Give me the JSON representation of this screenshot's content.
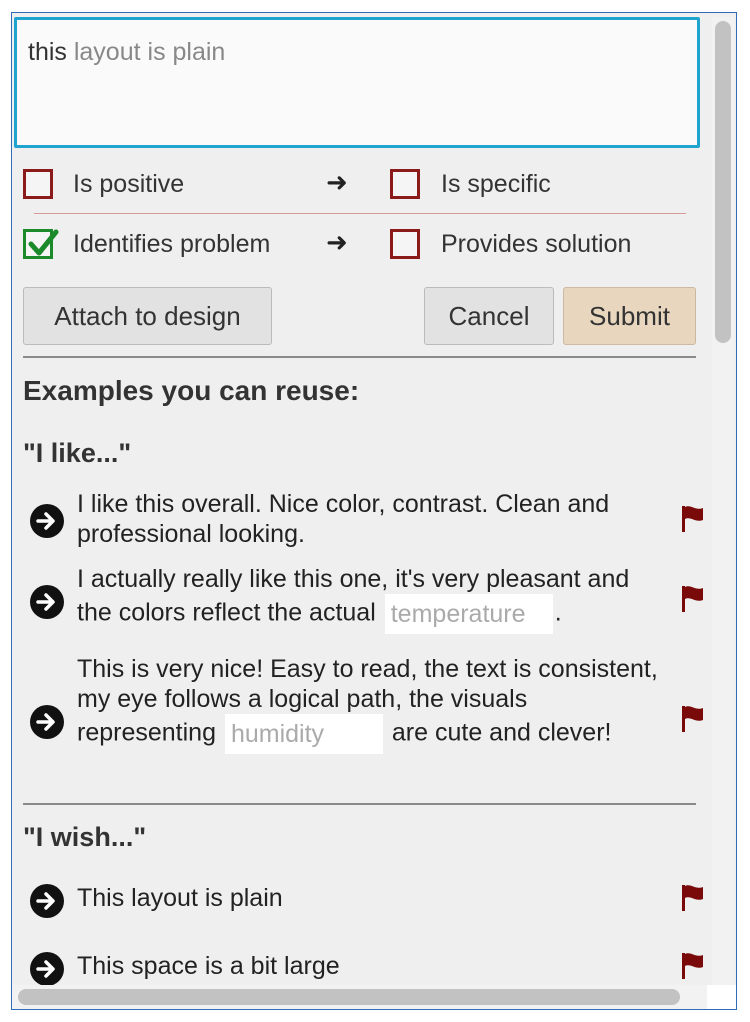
{
  "editor": {
    "typed_text": "this",
    "suggestion_text": " layout is plain"
  },
  "criteria": [
    {
      "label": "Is positive",
      "checked": false
    },
    {
      "label": "Is specific",
      "checked": false
    },
    {
      "label": "Identifies problem",
      "checked": true
    },
    {
      "label": "Provides solution",
      "checked": false
    }
  ],
  "arrow_glyph": "➜",
  "buttons": {
    "attach": "Attach to design",
    "cancel": "Cancel",
    "submit": "Submit"
  },
  "examples_heading": "Examples you can reuse:",
  "groups": [
    {
      "title": "\"I like...\"",
      "items": [
        {
          "text": "I like this overall. Nice color, contrast. Clean and professional looking."
        },
        {
          "text_before": "I actually really like this one, it's very pleasant and the colors reflect the actual",
          "blank": "temperature",
          "text_after": "."
        },
        {
          "text_before": "This is very nice! Easy to read, the text is consistent, my eye follows a logical path, the visuals representing",
          "blank": "humidity",
          "text_after": "are cute and clever!"
        }
      ]
    },
    {
      "title": "\"I wish...\"",
      "items": [
        {
          "text": "This layout is plain"
        },
        {
          "text": "This space is a bit large"
        }
      ]
    }
  ],
  "colors": {
    "focus_border": "#1ea4cf",
    "unchecked_border": "#8b1a1a",
    "checked_border": "#1a8a2a",
    "flag": "#7a0a0a",
    "submit_bg": "#e8d6bf"
  }
}
